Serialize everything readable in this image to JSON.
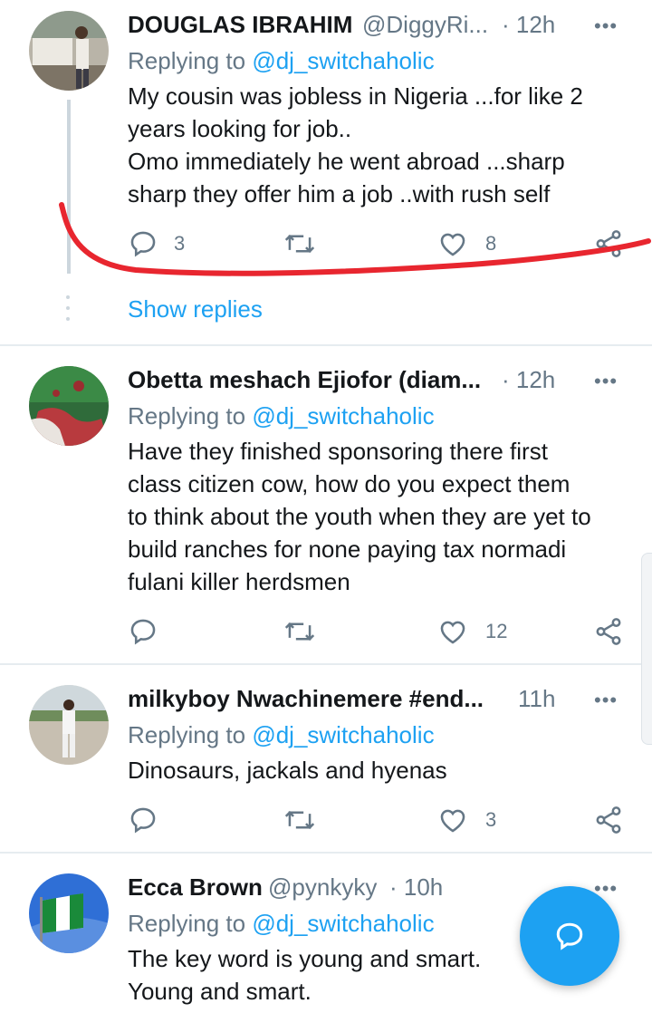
{
  "tweets": [
    {
      "name": "DOUGLAS IBRAHIM",
      "handle": "@DiggyRi...",
      "time": "· 12h",
      "replying_prefix": "Replying to ",
      "replying_to": "@dj_switchaholic",
      "text": "My cousin was jobless in Nigeria ...for like 2\nyears looking for job..\nOmo immediately he went abroad ...sharp\nsharp they offer him a job ..with rush self",
      "replies": "3",
      "retweets": "",
      "likes": "8"
    },
    {
      "name": "Obetta meshach Ejiofor (diam...",
      "handle": "",
      "time": "· 12h",
      "replying_prefix": "Replying to ",
      "replying_to": "@dj_switchaholic",
      "text": "Have they finished sponsoring there first\nclass citizen cow, how do you expect them\nto think about the youth when they are yet to\nbuild ranches for none paying tax normadi\nfulani killer herdsmen",
      "replies": "",
      "retweets": "",
      "likes": "12"
    },
    {
      "name": "milkyboy Nwachinemere #end...",
      "handle": "",
      "time": "11h",
      "replying_prefix": "Replying to ",
      "replying_to": "@dj_switchaholic",
      "text": "Dinosaurs, jackals and hyenas",
      "replies": "",
      "retweets": "",
      "likes": "3"
    },
    {
      "name": "Ecca Brown",
      "handle": "@pynkyky",
      "time": "· 10h",
      "replying_prefix": "Replying to ",
      "replying_to": "@dj_switchaholic",
      "text": "The key word is young and smart.\nYoung and smart."
    }
  ],
  "show_replies": "Show replies",
  "more_glyph": "•••",
  "colors": {
    "accent": "#1da1f2",
    "secondary_text": "#657786",
    "annotation_red": "#e8262f"
  },
  "icons": [
    "reply-icon",
    "retweet-icon",
    "like-icon",
    "share-icon",
    "compose-reply-icon",
    "more-icon"
  ]
}
